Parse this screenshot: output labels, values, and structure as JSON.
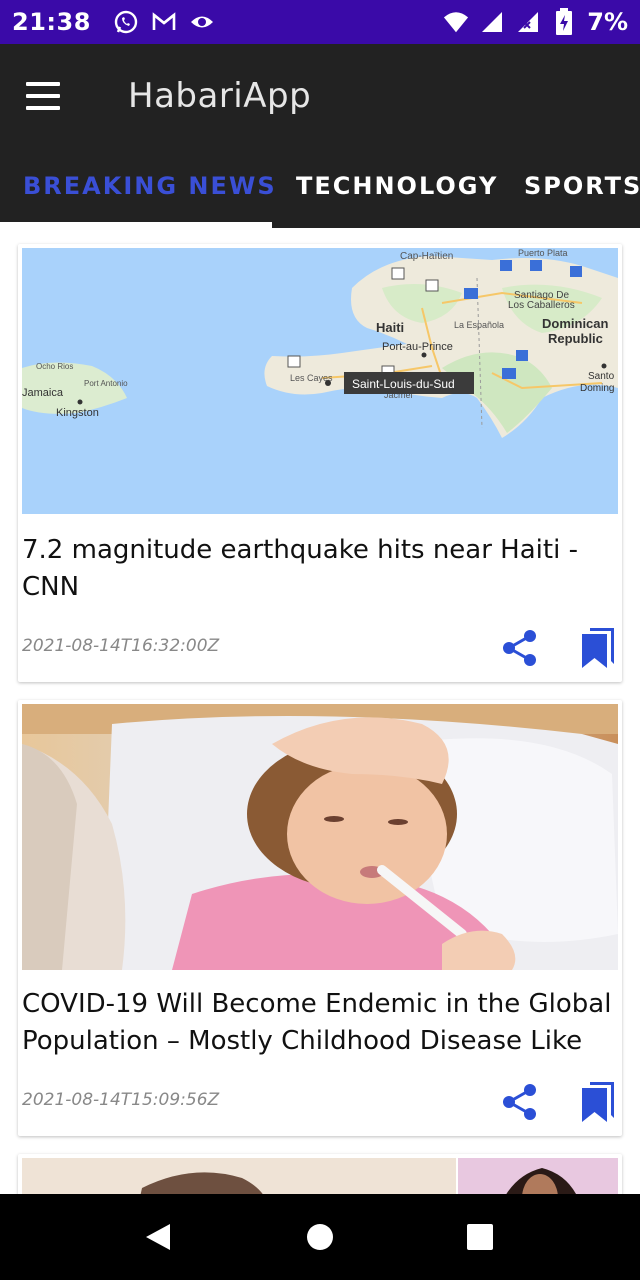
{
  "status_bar": {
    "time": "21:38",
    "battery": "7%",
    "icons": [
      "whatsapp-icon",
      "gmail-icon",
      "eye-icon",
      "wifi-icon",
      "signal-icon",
      "signal-x-icon",
      "battery-charging-icon"
    ]
  },
  "app_bar": {
    "title": "HabariApp",
    "menu_icon": "hamburger-menu-icon"
  },
  "tabs": [
    {
      "label": "BREAKING NEWS",
      "active": true
    },
    {
      "label": "TECHNOLOGY",
      "active": false
    },
    {
      "label": "SPORTS",
      "active": false
    }
  ],
  "articles": [
    {
      "title": "7.2 magnitude earthquake hits near Haiti - CNN",
      "date": "2021-08-14T16:32:00Z",
      "map_labels": {
        "cap_haitien": "Cap-Haïtien",
        "puerto_plata": "Puerto Plata",
        "santiago": "Santiago De",
        "santiago2": "Los Caballeros",
        "haiti": "Haiti",
        "la_espanola": "La Española",
        "dominican": "Dominican",
        "republic": "Republic",
        "port_au_prince": "Port-au-Prince",
        "ocho_rios": "Ocho Rios",
        "port_antonio": "Port Antonio",
        "jamaica": "Jamaica",
        "kingston": "Kingston",
        "les_cayes": "Les Cayes",
        "jacmel": "Jacmel",
        "santo": "Santo",
        "domingo": "Doming",
        "tooltip": "Saint-Louis-du-Sud"
      }
    },
    {
      "title": "COVID-19 Will Become Endemic in the Global Population – Mostly Childhood Disease Like",
      "date": "2021-08-14T15:09:56Z"
    }
  ],
  "colors": {
    "status_bar": "#3a0aa8",
    "app_bar": "#222222",
    "active_tab": "#3a4fd6",
    "icon_blue": "#2b4fd6"
  },
  "nav_bar": {
    "buttons": [
      "back-icon",
      "home-icon",
      "recents-icon"
    ]
  }
}
